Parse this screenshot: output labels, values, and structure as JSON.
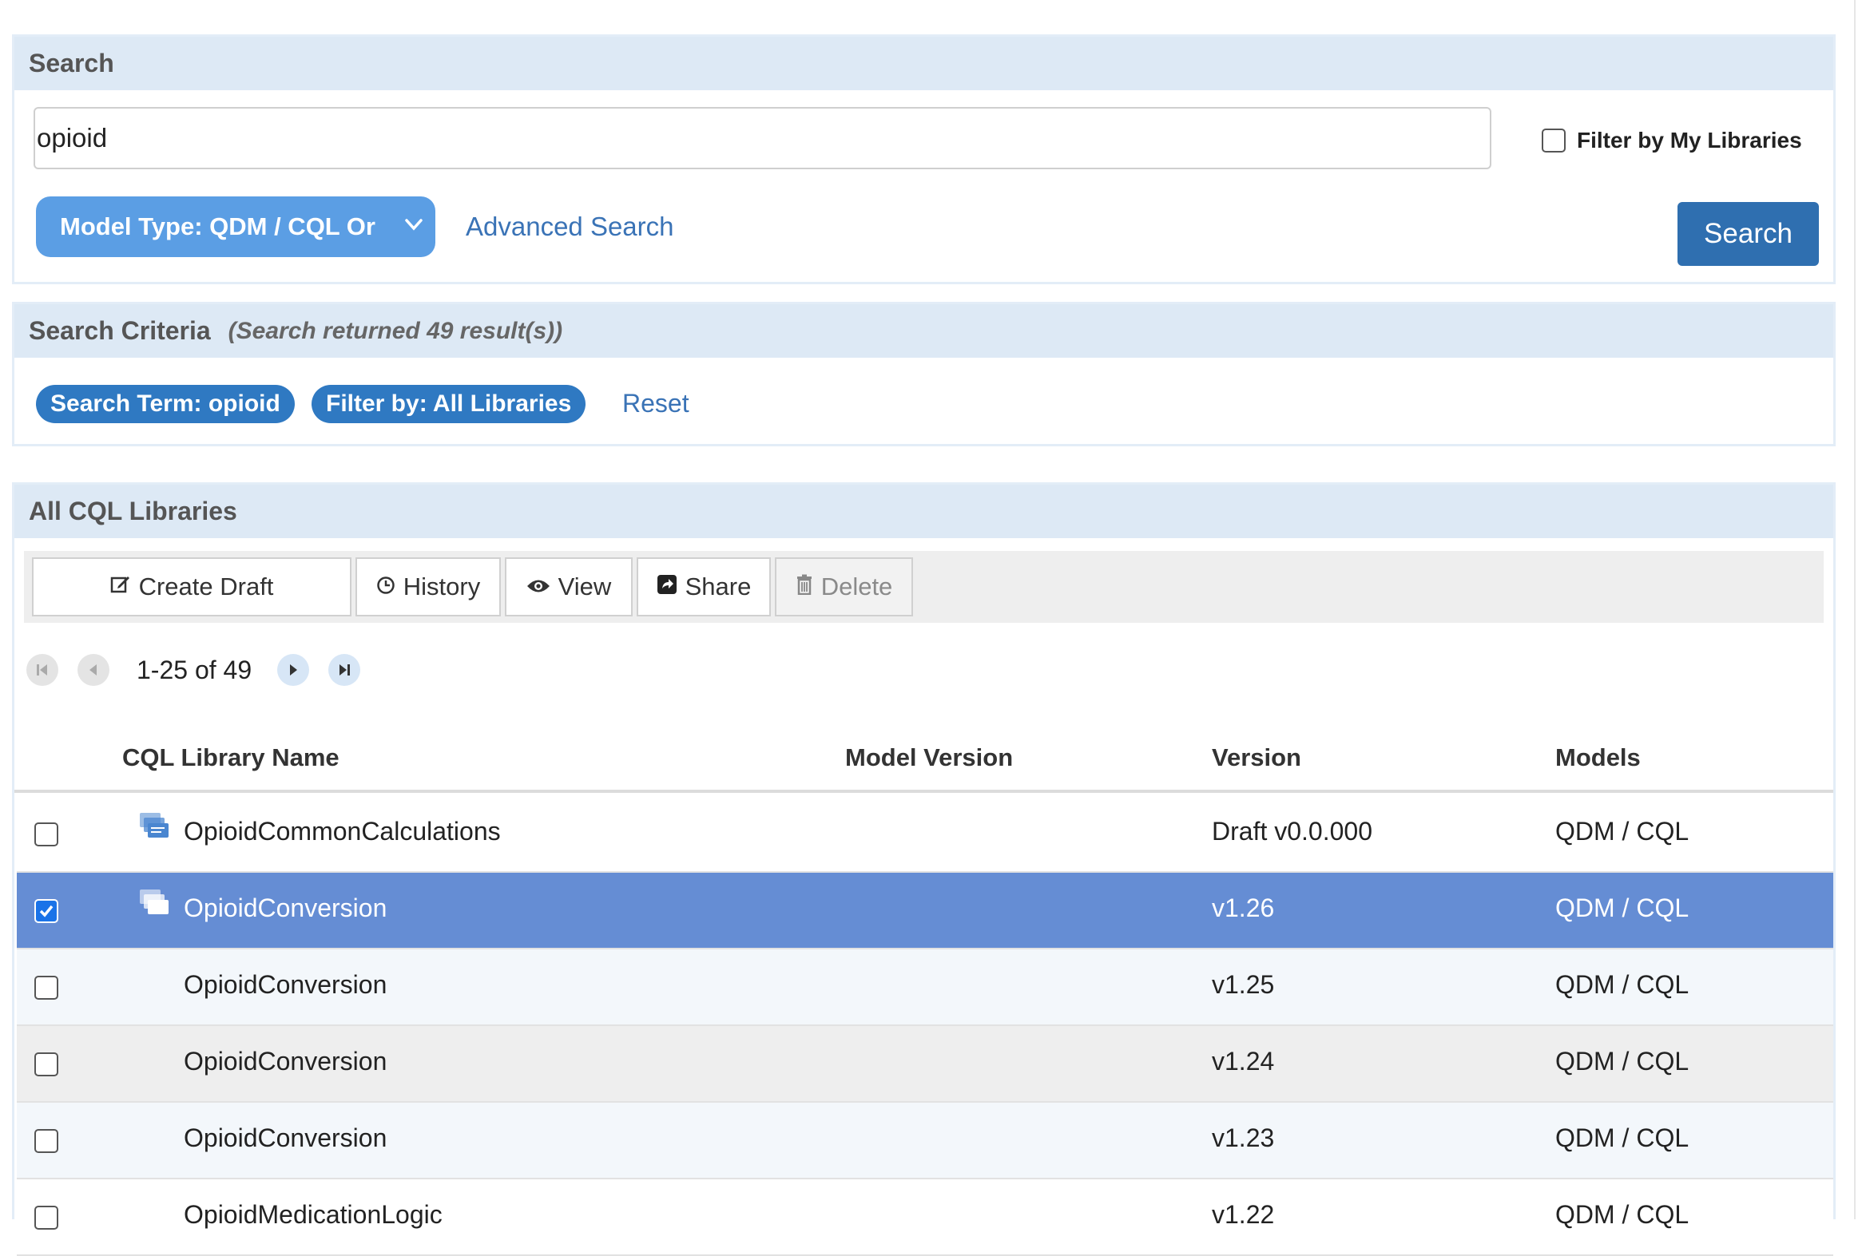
{
  "search": {
    "title": "Search",
    "input_value": "opioid",
    "filter_my_libraries_label": "Filter by My Libraries",
    "model_type_label": "Model Type: QDM / CQL Or",
    "advanced_search_label": "Advanced Search",
    "search_button_label": "Search"
  },
  "criteria": {
    "title": "Search Criteria",
    "subtitle": "(Search returned 49 result(s))",
    "chips": {
      "term": "Search Term: opioid",
      "filter": "Filter by: All Libraries"
    },
    "reset_label": "Reset"
  },
  "libraries": {
    "title": "All CQL Libraries",
    "toolbar": {
      "create_draft": "Create Draft",
      "history": "History",
      "view": "View",
      "share": "Share",
      "delete": "Delete"
    },
    "pager_text": "1-25 of 49",
    "columns": {
      "name": "CQL Library Name",
      "model_version": "Model Version",
      "version": "Version",
      "models": "Models"
    },
    "rows": [
      {
        "name": "OpioidCommonCalculations",
        "version": "Draft v0.0.000",
        "models": "QDM / CQL",
        "checked": false,
        "icon": "library-family-icon"
      },
      {
        "name": "OpioidConversion",
        "version": "v1.26",
        "models": "QDM / CQL",
        "checked": true,
        "icon": "library-family-icon"
      },
      {
        "name": "OpioidConversion",
        "version": "v1.25",
        "models": "QDM / CQL",
        "checked": false
      },
      {
        "name": "OpioidConversion",
        "version": "v1.24",
        "models": "QDM / CQL",
        "checked": false
      },
      {
        "name": "OpioidConversion",
        "version": "v1.23",
        "models": "QDM / CQL",
        "checked": false
      },
      {
        "name": "OpioidMedicationLogic",
        "version": "v1.22",
        "models": "QDM / CQL",
        "checked": false
      }
    ]
  },
  "colors": {
    "panel_header": "#dde9f5",
    "primary": "#2f6fb0",
    "chip": "#2f79c2",
    "selected_row": "#658dd4",
    "link": "#3a73b6"
  }
}
